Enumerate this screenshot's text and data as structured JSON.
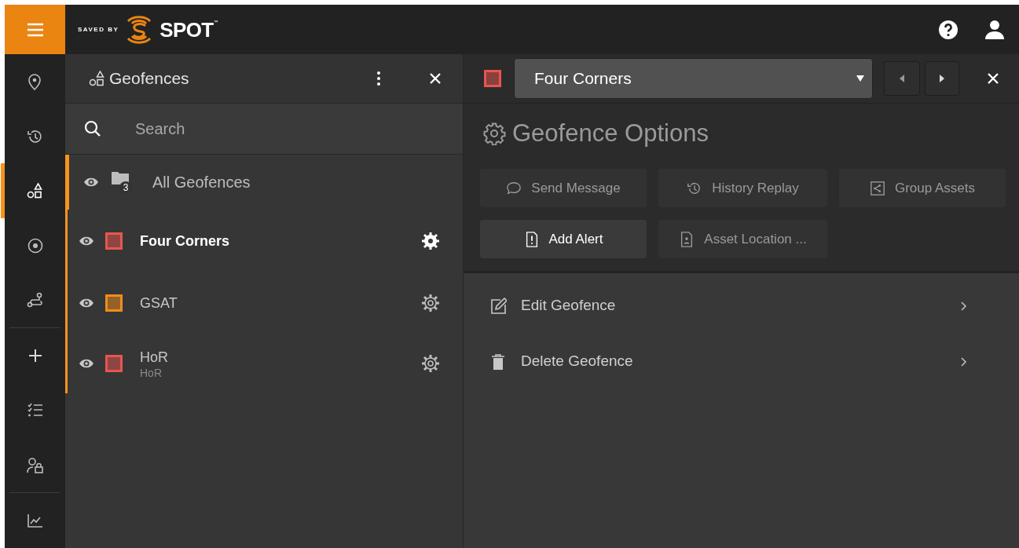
{
  "logo": {
    "tagline": "SAVED BY",
    "brand": "SPOT",
    "mark": "™"
  },
  "rail": [
    [
      {
        "kind": "pin",
        "selected": false
      },
      {
        "kind": "history",
        "selected": false
      },
      {
        "kind": "shapes",
        "selected": true
      },
      {
        "kind": "target",
        "selected": false
      },
      {
        "kind": "route",
        "selected": false
      }
    ],
    [
      {
        "kind": "plus",
        "selected": false
      },
      {
        "kind": "checklist",
        "selected": false
      },
      {
        "kind": "userlock",
        "selected": false
      }
    ],
    [
      {
        "kind": "chart",
        "selected": false
      }
    ]
  ],
  "geofence_panel": {
    "title": "Geofences",
    "search": {
      "placeholder": "Search"
    },
    "all_item": {
      "label": "All Geofences",
      "count": "3"
    },
    "items": [
      {
        "name": "Four Corners",
        "color": "#e8564f",
        "selected": true
      },
      {
        "name": "GSAT",
        "color": "#f28c1a",
        "selected": false
      },
      {
        "name": "HoR",
        "subtitle": "HoR",
        "color": "#e8564f",
        "selected": false
      }
    ]
  },
  "detail_panel": {
    "selector": {
      "value": "Four Corners",
      "color": "#e8564f"
    },
    "title": "Geofence Options",
    "actions": [
      {
        "label": "Send Message",
        "kind": "message",
        "disabled": true
      },
      {
        "label": "History Replay",
        "kind": "history",
        "disabled": true
      },
      {
        "label": "Group Assets",
        "kind": "share",
        "disabled": true
      },
      {
        "label": "Add Alert",
        "kind": "alert",
        "disabled": false
      },
      {
        "label": "Asset Location ...",
        "kind": "report",
        "disabled": true
      }
    ],
    "menu": [
      {
        "label": "Edit Geofence",
        "kind": "edit"
      },
      {
        "label": "Delete Geofence",
        "kind": "trash"
      }
    ]
  }
}
